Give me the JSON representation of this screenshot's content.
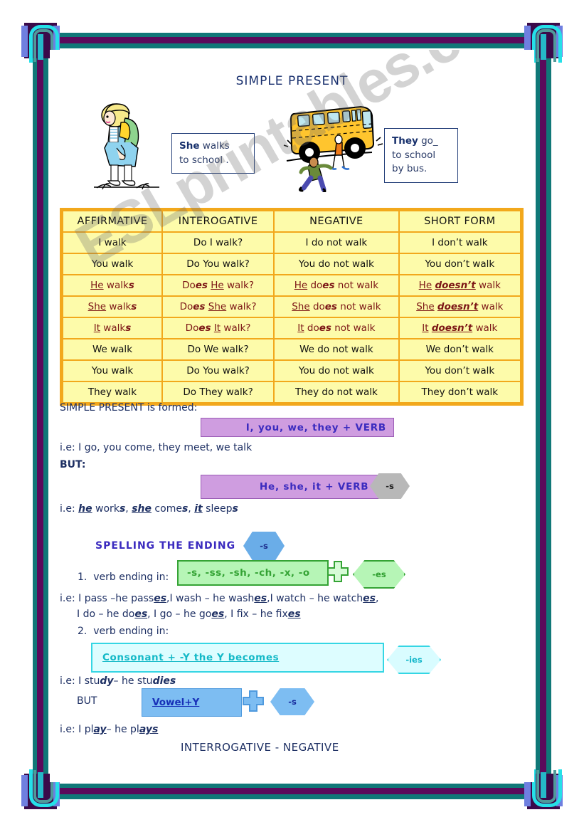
{
  "document": {
    "title": "SIMPLE PRESENT",
    "watermark": "ESLprintables.com"
  },
  "illustrations": {
    "girl_alt": "girl-with-backpack-illustration",
    "bus_alt": "school-bus-with-children-illustration"
  },
  "speech_boxes": [
    {
      "id": "she-walks",
      "bold": "She",
      "rest": " walks",
      "line2": "to school ."
    },
    {
      "id": "they-go",
      "bold": "They",
      "rest": " go_",
      "line2": "to school",
      "line3": "by bus."
    }
  ],
  "table": {
    "headers": [
      "AFFIRMATIVE",
      "INTEROGATIVE",
      "NEGATIVE",
      "SHORT FORM"
    ],
    "rows": [
      {
        "third": false,
        "cells": [
          "I walk",
          "Do I walk?",
          "I do not walk",
          "I don’t walk"
        ]
      },
      {
        "third": false,
        "cells": [
          "You walk",
          "Do You walk?",
          "You do not walk",
          "You don’t walk"
        ]
      },
      {
        "third": true,
        "cells": [
          "He walks",
          "Does He walk?",
          "He does not walk",
          "He doesn’t walk"
        ]
      },
      {
        "third": true,
        "cells": [
          "She walks",
          "Does She walk?",
          "She does not walk",
          "She doesn’t walk"
        ]
      },
      {
        "third": true,
        "cells": [
          "It walks",
          "Does It walk?",
          "It does not walk",
          "It doesn’t walk"
        ]
      },
      {
        "third": false,
        "cells": [
          "We walk",
          "Do We walk?",
          "We do not walk",
          "We don’t walk"
        ]
      },
      {
        "third": false,
        "cells": [
          "You walk",
          "Do You walk?",
          "You do not walk",
          "You don’t walk"
        ]
      },
      {
        "third": false,
        "cells": [
          "They walk",
          "Do They walk?",
          "They do not walk",
          "They don’t walk"
        ]
      }
    ]
  },
  "explanation": {
    "formed_label": "SIMPLE PRESENT is formed:",
    "rule1_box": "I, you, we, they + VERB",
    "example1": "i.e: I go,  you come, they meet, we talk",
    "but_label": "BUT:",
    "rule2_box": "He, she, it + VERB +",
    "rule2_hex": "-s",
    "example2_prefix": "i.e: ",
    "example2": "he works, she comes, it sleeps"
  },
  "spelling": {
    "heading": "SPELLING THE ENDING",
    "heading_hex": "-s",
    "item1_number": "1.",
    "item1_label": "verb ending in:",
    "item1_box": "-s, -ss, -sh, -ch, -x, -o",
    "item1_hex": "-es",
    "item1_example_line1": "i.e: I pass –he passes,I wash – he washes,I watch – he watches,",
    "item1_example_line2": "I do – he does, I go – he goes, I fix – he fixes",
    "item2_number": "2.",
    "item2_label": "verb ending in:",
    "item2_box": "Consonant + -Y the Y becomes",
    "item2_hex": "-ies",
    "item2_example": "i.e: I study– he studies",
    "but_label": "BUT",
    "item3_box": "Vowel+Y",
    "item3_hex": "-s",
    "item3_example": "i.e: I play– he plays"
  },
  "footer": {
    "caption": "INTERROGATIVE - NEGATIVE"
  },
  "colors": {
    "frame_teal": "#107878",
    "frame_purple": "#5b0a5b",
    "table_border": "#f2a81c",
    "table_cell": "#fdfbaa",
    "third_person": "#7c1616",
    "lavender": "#cf9de0",
    "green": "#b6f5b6",
    "cyan": "#ddfdff",
    "blue": "#7dbdf2",
    "title_blue": "#19306e"
  }
}
